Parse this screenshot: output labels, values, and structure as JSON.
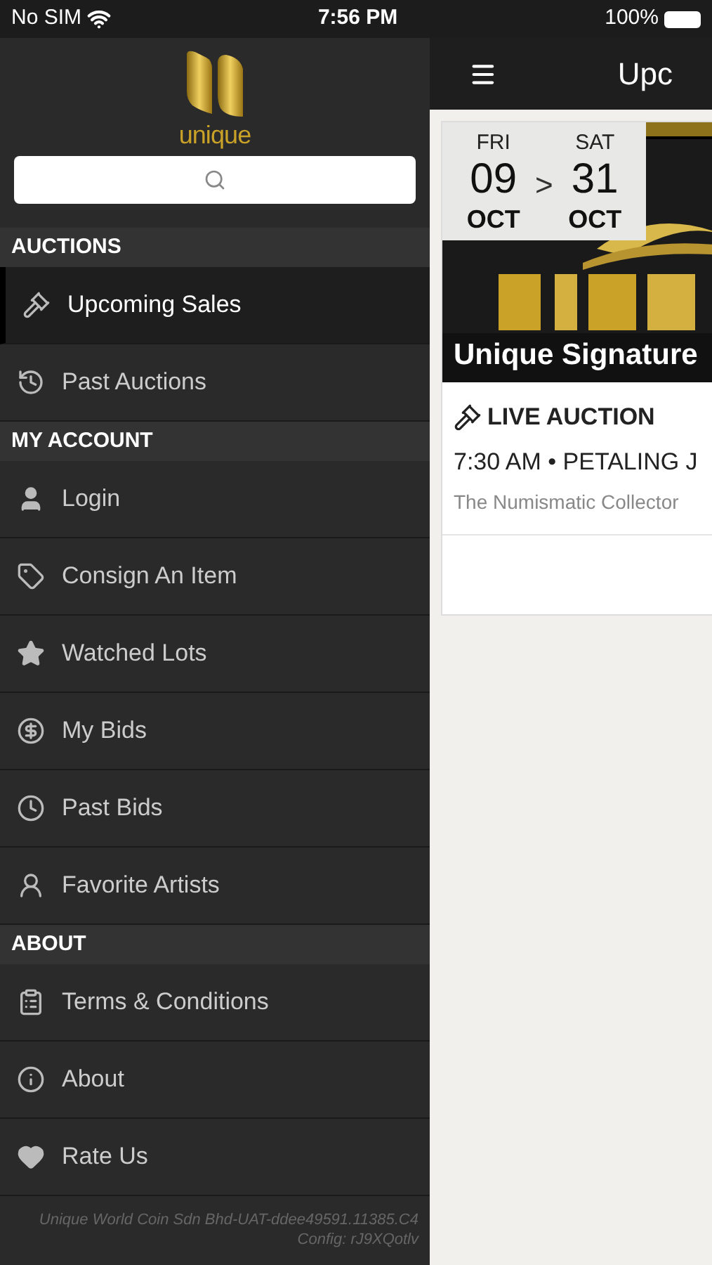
{
  "status_bar": {
    "carrier": "No SIM",
    "time": "7:56 PM",
    "battery": "100%"
  },
  "sidebar": {
    "logo": "unique",
    "sections": [
      {
        "title": "AUCTIONS",
        "items": [
          {
            "label": "Upcoming Sales",
            "selected": true
          },
          {
            "label": "Past Auctions",
            "selected": false
          }
        ]
      },
      {
        "title": "MY ACCOUNT",
        "items": [
          {
            "label": "Login",
            "selected": false
          },
          {
            "label": "Consign An Item",
            "selected": false
          },
          {
            "label": "Watched Lots",
            "selected": false
          },
          {
            "label": "My Bids",
            "selected": false
          },
          {
            "label": "Past Bids",
            "selected": false
          },
          {
            "label": "Favorite Artists",
            "selected": false
          }
        ]
      },
      {
        "title": "ABOUT",
        "items": [
          {
            "label": "Terms & Conditions",
            "selected": false
          },
          {
            "label": "About",
            "selected": false
          },
          {
            "label": "Rate Us",
            "selected": false
          }
        ]
      }
    ],
    "footer": [
      "Unique World Coin Sdn Bhd-UAT-ddee49591.11385.C4",
      "Config: rJ9XQotlv"
    ]
  },
  "header": {
    "title": "Upc"
  },
  "sale_card": {
    "start": {
      "day": "FRI",
      "date": "09",
      "month": "OCT"
    },
    "separator": ">",
    "end": {
      "day": "SAT",
      "date": "31",
      "month": "OCT"
    },
    "banner_title": "Unique Signature",
    "type": "LIVE AUCTION",
    "time_place": "7:30 AM • PETALING J",
    "venue": "The Numismatic Collector"
  }
}
